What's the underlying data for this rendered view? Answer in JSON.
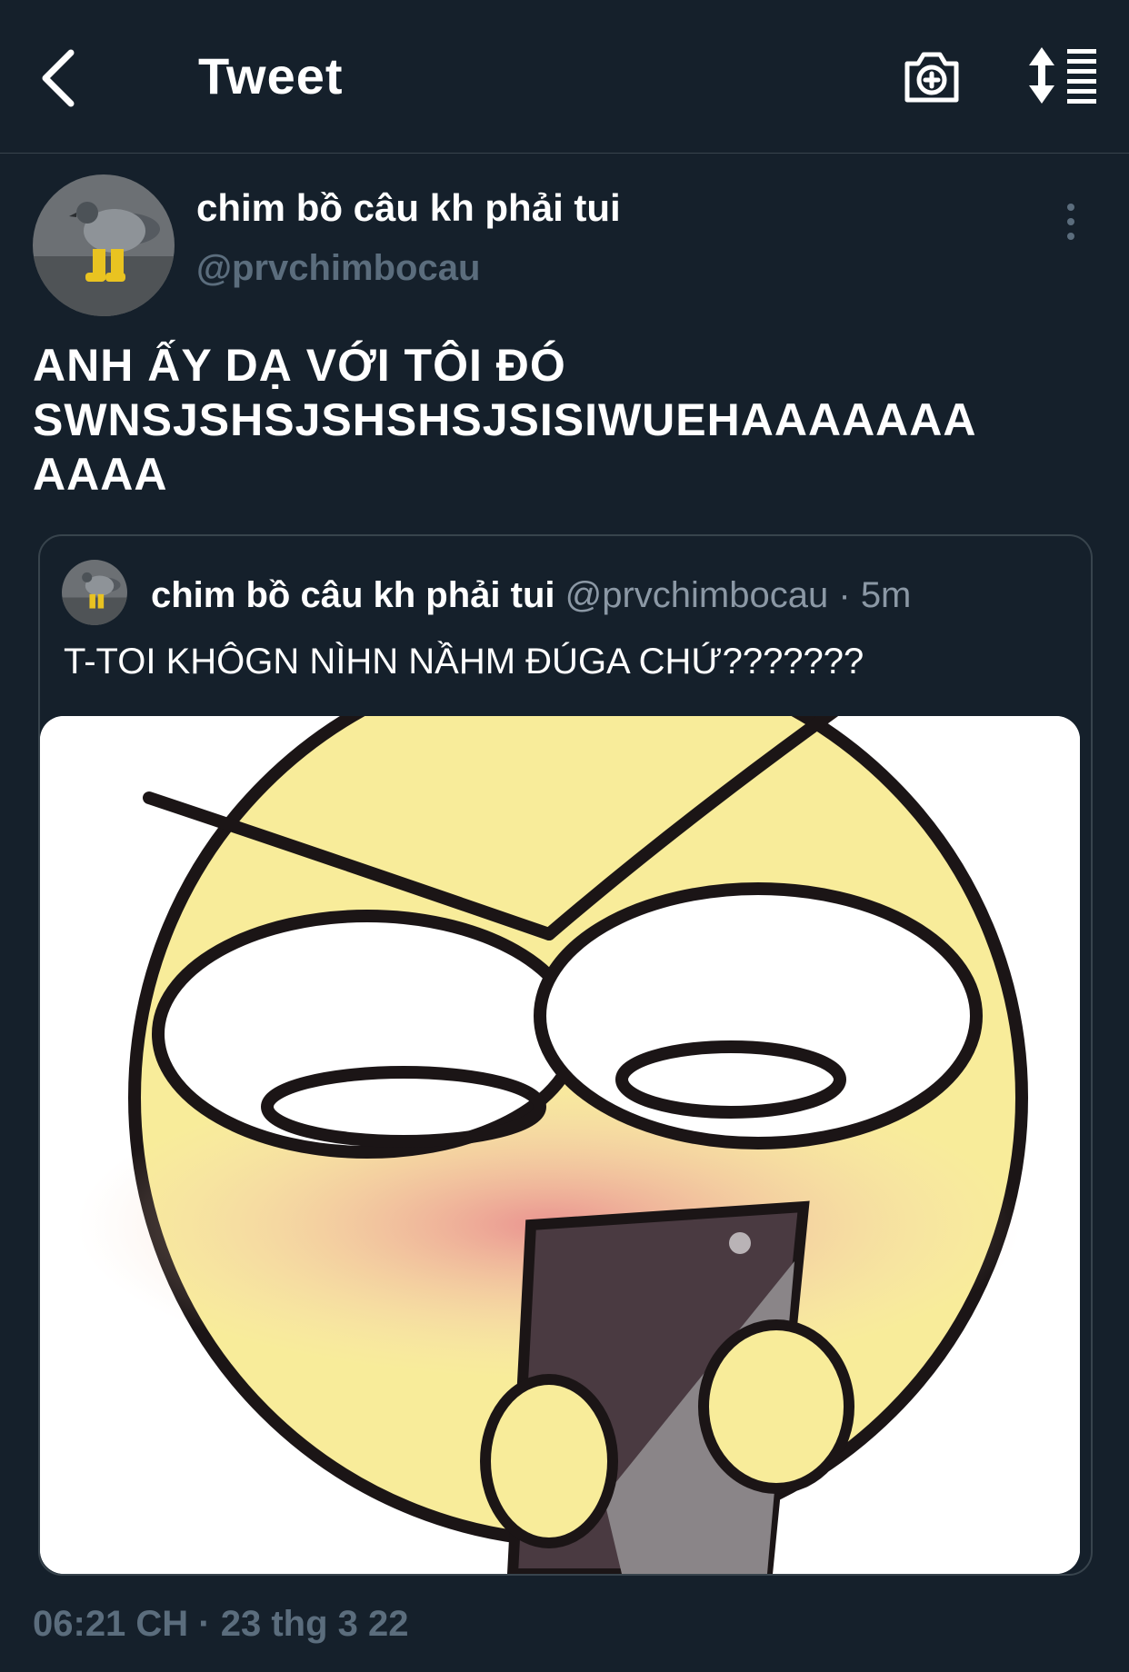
{
  "header": {
    "title": "Tweet",
    "back_icon": "chevron-left-icon",
    "camera_icon": "camera-plus-icon",
    "sort_icon": "sort-list-icon"
  },
  "author": {
    "name": "chim bồ câu kh phải tui",
    "handle": "@prvchimbocau"
  },
  "tweet": {
    "text_lines": [
      "ANH ẤY DẠ VỚI TÔI ĐÓ",
      "SWNSJSHSJSHSHSJSISIWUEHAAAAAAA",
      "AAAA"
    ],
    "timestamp": "06:21 CH · 23 thg 3 22"
  },
  "quote": {
    "name": "chim bồ câu kh phải tui",
    "handle": "@prvchimbocau",
    "separator": "·",
    "time": "5m",
    "text": "T-TOI KHÔGN NÌHN NẦHM ĐÚGA CHỨ???????"
  },
  "colors": {
    "background": "#15202b",
    "border": "#38444d",
    "secondary_text": "#5b6d7d",
    "quote_secondary": "#8b98a5"
  }
}
